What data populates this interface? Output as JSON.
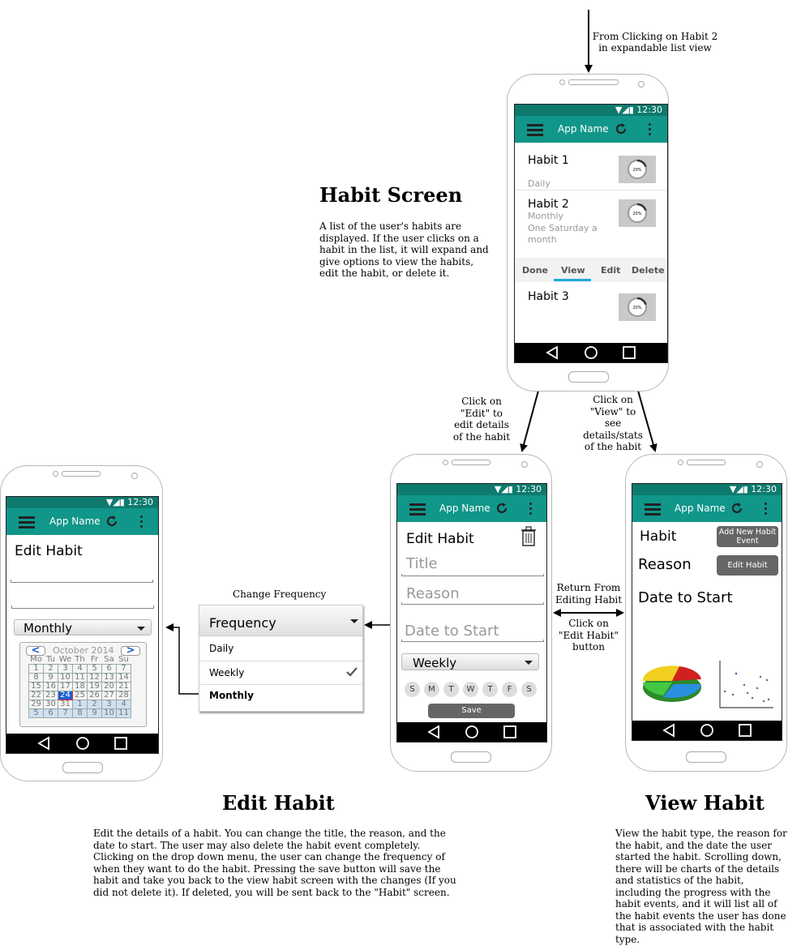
{
  "habit_screen": {
    "heading": "Habit Screen",
    "description": [
      "A list of the user's habits are",
      "displayed. If the user clicks on a",
      "habit in the list, it will expand and",
      "give options to view the habits,",
      "edit the habit, or delete it."
    ],
    "entry_note": [
      "From Clicking on Habit 2",
      "in expandable list view"
    ]
  },
  "status": {
    "time": "12:30"
  },
  "app": {
    "name": "App Name"
  },
  "habit_list": {
    "items": [
      {
        "title": "Habit 1",
        "sub": "Daily",
        "progress": "20%"
      },
      {
        "title": "Habit 2",
        "sub": "Monthly",
        "sub2": "One Saturday a",
        "sub3": "month",
        "progress": "20%"
      },
      {
        "title": "Habit 3",
        "progress": "20%"
      }
    ],
    "actions": [
      "Done",
      "View",
      "Edit",
      "Delete"
    ]
  },
  "edges": {
    "to_edit": [
      "Click on",
      "\"Edit\" to",
      "edit details",
      "of the habit"
    ],
    "to_view": [
      "Click on",
      "\"View\" to",
      "see",
      "details/stats",
      "of the habit"
    ],
    "return_from": [
      "Return From",
      "Editing Habit"
    ],
    "click_edit_habit": [
      "Click on",
      "\"Edit Habit\"",
      "button"
    ]
  },
  "edit_habit": {
    "title": "Edit Habit",
    "placeholder_title": "Title",
    "placeholder_reason": "Reason",
    "placeholder_date": "Date to Start",
    "frequency": "Weekly",
    "days": [
      "S",
      "M",
      "T",
      "W",
      "T",
      "F",
      "S"
    ],
    "save": "Save",
    "heading": "Edit Habit",
    "description": [
      "Edit the details of a habit. You can change the title, the reason, and the",
      "date to start. The user may also delete the habit event completely.",
      "Clicking on the drop down menu, the user can change the frequency of",
      "when they want to do the habit. Pressing the save button will save the",
      "habit and take you back to the view habit screen with the changes (If you",
      "did not delete it). If deleted, you will be sent back to the \"Habit\" screen."
    ]
  },
  "frequency_popup": {
    "label": "Change Frequency",
    "header": "Frequency",
    "options": [
      "Daily",
      "Weekly",
      "Monthly"
    ],
    "checked": "Weekly"
  },
  "edit_habit_calendar": {
    "title": "Edit Habit",
    "frequency": "Monthly",
    "month": "October 2014",
    "prev": "<",
    "next": ">",
    "weekdays": [
      "Mo",
      "Tu",
      "We",
      "Th",
      "Fr",
      "Sa",
      "Su"
    ],
    "rows": [
      [
        "1",
        "2",
        "3",
        "4",
        "5",
        "6",
        "7"
      ],
      [
        "8",
        "9",
        "10",
        "11",
        "12",
        "13",
        "14"
      ],
      [
        "15",
        "16",
        "17",
        "18",
        "19",
        "20",
        "21"
      ],
      [
        "22",
        "23",
        "24",
        "25",
        "26",
        "27",
        "28"
      ],
      [
        "29",
        "30",
        "31",
        "1",
        "2",
        "3",
        "4"
      ],
      [
        "5",
        "6",
        "7",
        "8",
        "9",
        "10",
        "11"
      ]
    ],
    "selected": "24"
  },
  "view_habit": {
    "habit_label": "Habit",
    "reason_label": "Reason",
    "date_label": "Date to Start",
    "add_event": [
      "Add New Habit",
      "Event"
    ],
    "edit_habit": "Edit Habit",
    "heading": "View Habit",
    "description": [
      "View the habit type, the reason for",
      "the habit, and the date the user",
      "started the habit. Scrolling down,",
      "there will be charts of the details",
      "and statistics of the habit,",
      "including the progress with the",
      "habit events, and it will list all of",
      "the habit events the user has done",
      "that is associated with the habit",
      "type."
    ]
  },
  "colors": {
    "status_bar": "#0e7a6e",
    "app_bar": "#11968a",
    "selected_tab": "#1ea7d8"
  }
}
